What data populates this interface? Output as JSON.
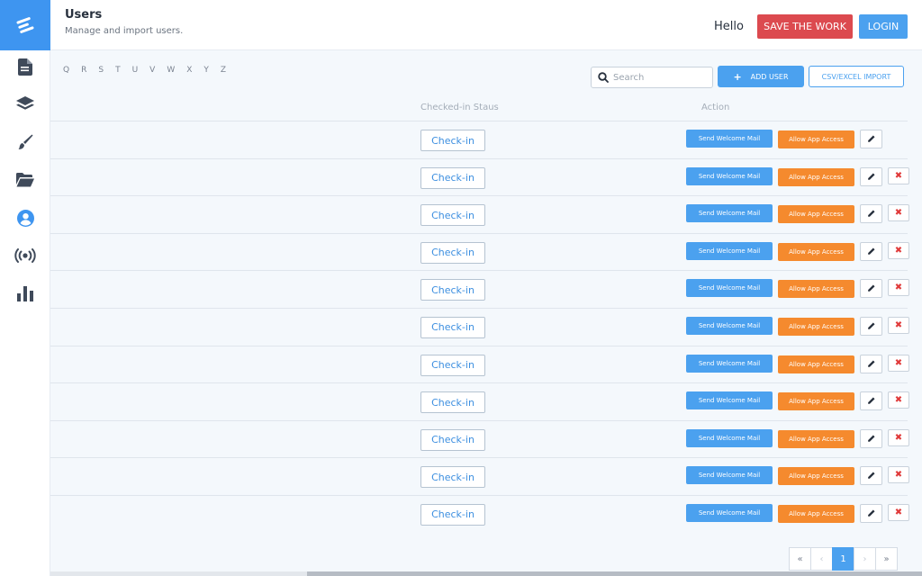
{
  "header": {
    "title": "Users",
    "subtitle": "Manage and import users.",
    "greeting": "Hello",
    "save_label": "SAVE THE WORK",
    "login_label": "LOGIN"
  },
  "sidebar": {
    "items": [
      {
        "icon": "document-icon"
      },
      {
        "icon": "layers-icon"
      },
      {
        "icon": "brush-icon"
      },
      {
        "icon": "folder-open-icon"
      },
      {
        "icon": "user-circle-icon",
        "active": true
      },
      {
        "icon": "broadcast-icon"
      },
      {
        "icon": "bar-chart-icon"
      }
    ]
  },
  "alphabet": [
    "Q",
    "R",
    "S",
    "T",
    "U",
    "V",
    "W",
    "X",
    "Y",
    "Z"
  ],
  "toolbar": {
    "search_placeholder": "Search",
    "add_user_label": "ADD USER",
    "import_label": "CSV/EXCEL IMPORT"
  },
  "table": {
    "columns": {
      "status": "Checked-in Staus",
      "action": "Action"
    },
    "rows": [
      {
        "checkin": "Check-in",
        "welcome": "Send Welcome Mail",
        "allow": "Allow App Access",
        "deletable": false
      },
      {
        "checkin": "Check-in",
        "welcome": "Send Welcome Mail",
        "allow": "Allow App Access",
        "deletable": true
      },
      {
        "checkin": "Check-in",
        "welcome": "Send Welcome Mail",
        "allow": "Allow App Access",
        "deletable": true
      },
      {
        "checkin": "Check-in",
        "welcome": "Send Welcome Mail",
        "allow": "Allow App Access",
        "deletable": true
      },
      {
        "checkin": "Check-in",
        "welcome": "Send Welcome Mail",
        "allow": "Allow App Access",
        "deletable": true
      },
      {
        "checkin": "Check-in",
        "welcome": "Send Welcome Mail",
        "allow": "Allow App Access",
        "deletable": true
      },
      {
        "checkin": "Check-in",
        "welcome": "Send Welcome Mail",
        "allow": "Allow App Access",
        "deletable": true
      },
      {
        "checkin": "Check-in",
        "welcome": "Send Welcome Mail",
        "allow": "Allow App Access",
        "deletable": true
      },
      {
        "checkin": "Check-in",
        "welcome": "Send Welcome Mail",
        "allow": "Allow App Access",
        "deletable": true
      },
      {
        "checkin": "Check-in",
        "welcome": "Send Welcome Mail",
        "allow": "Allow App Access",
        "deletable": true
      },
      {
        "checkin": "Check-in",
        "welcome": "Send Welcome Mail",
        "allow": "Allow App Access",
        "deletable": true
      }
    ]
  },
  "pagination": {
    "first": "«",
    "prev": "‹",
    "current": "1",
    "next": "›",
    "last": "»"
  },
  "colors": {
    "primary": "#4ba1ef",
    "danger": "#dc4a4f",
    "warning": "#f58a2e"
  }
}
